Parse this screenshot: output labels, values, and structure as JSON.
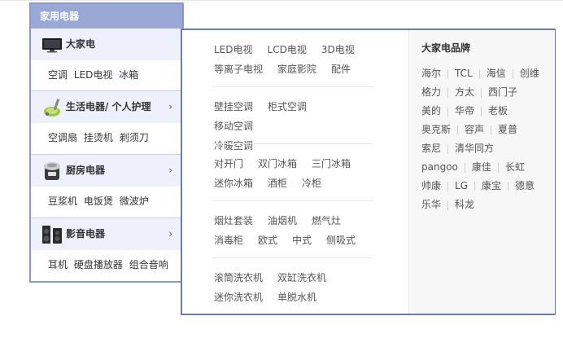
{
  "menu": {
    "title": "家用电器",
    "categories": [
      {
        "name": "大家电",
        "icon": "tv-icon",
        "subs": [
          "空调",
          "LED电视",
          "冰箱"
        ],
        "arrow": ""
      },
      {
        "name": "生活电器/ 个人护理",
        "icon": "vacuum-cleaner-icon",
        "subs": [
          "空调扇",
          "挂烫机",
          "剃须刀"
        ],
        "arrow": "›"
      },
      {
        "name": "厨房电器",
        "icon": "rice-cooker-icon",
        "subs": [
          "豆浆机",
          "电饭煲",
          "微波炉"
        ],
        "arrow": "›"
      },
      {
        "name": "影音电器",
        "icon": "speaker-icon",
        "subs": [
          "耳机",
          "硬盘播放器",
          "组合音响"
        ],
        "arrow": "›"
      }
    ]
  },
  "panel": {
    "groups": [
      [
        "LED电视",
        "LCD电视",
        "3D电视",
        "等离子电视",
        "家庭影院",
        "配件"
      ],
      [
        "壁挂空调",
        "柜式空调",
        "移动空调",
        "冷暖空调"
      ],
      [
        "对开门",
        "双门冰箱",
        "三门冰箱",
        "迷你冰箱",
        "酒柜",
        "冷柜"
      ],
      [
        "烟灶套装",
        "油烟机",
        "燃气灶",
        "消毒柜",
        "欧式",
        "中式",
        "侧吸式"
      ],
      [
        "滚筒洗衣机",
        "双缸洗衣机",
        "迷你洗衣机",
        "单脱水机"
      ]
    ],
    "brand_title": "大家电品牌",
    "brand_rows": [
      [
        "海尔",
        "TCL",
        "海信",
        "创维"
      ],
      [
        "格力",
        "方太",
        "西门子"
      ],
      [
        "美的",
        "华帝",
        "老板"
      ],
      [
        "奥克斯",
        "容声",
        "夏普"
      ],
      [
        "索尼",
        "清华同方"
      ],
      [
        "pangoo",
        "康佳",
        "长虹"
      ],
      [
        "帅康",
        "LG",
        "康宝",
        "德意"
      ],
      [
        "乐华",
        "科龙"
      ]
    ]
  }
}
